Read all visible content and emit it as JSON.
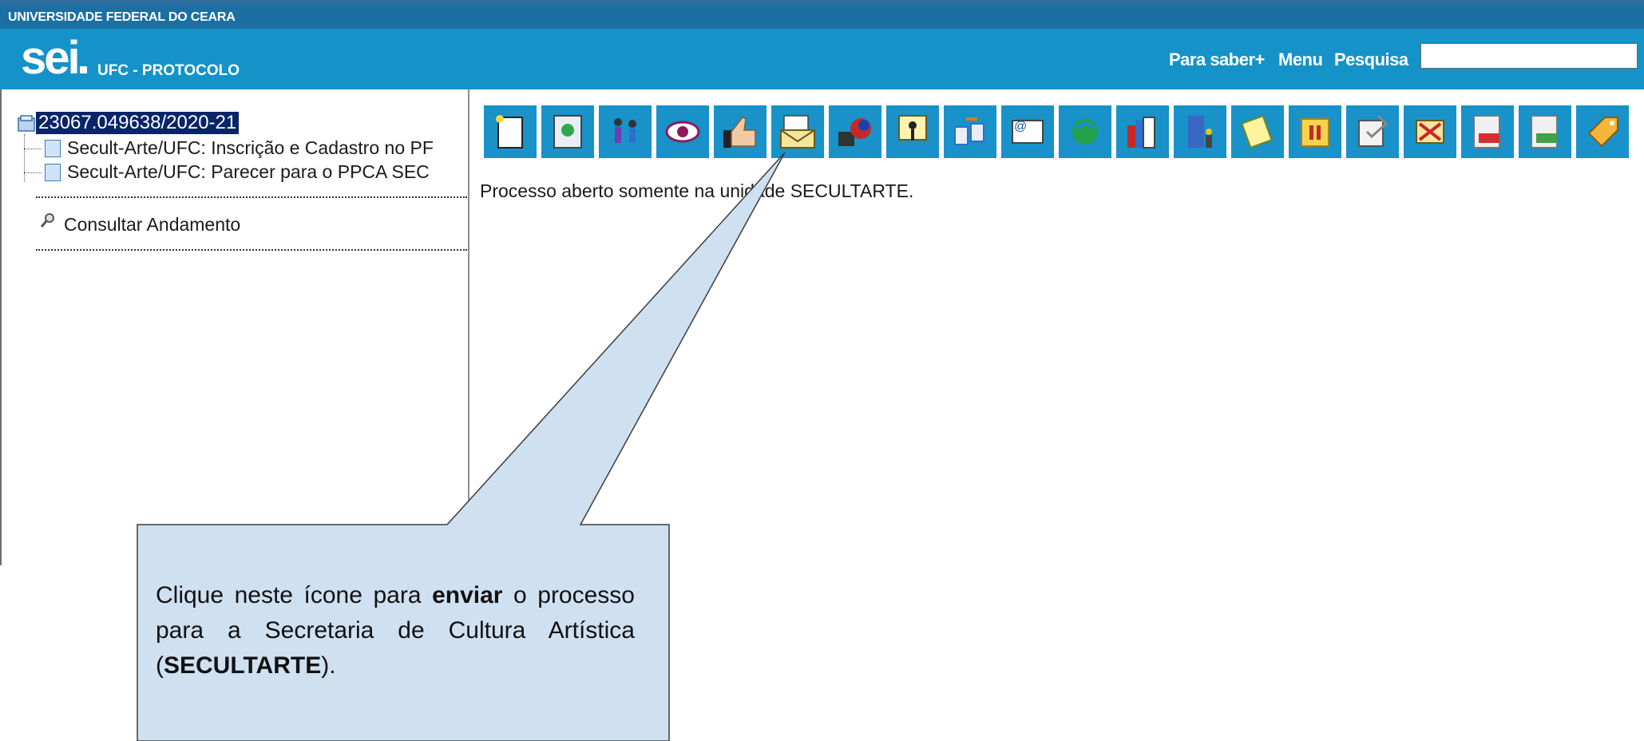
{
  "header": {
    "org_name": "UNIVERSIDADE FEDERAL DO CEARA",
    "logo_text": "sei",
    "system_name": "UFC - PROTOCOLO",
    "links": [
      "Para saber+",
      "Menu",
      "Pesquisa"
    ],
    "search_value": ""
  },
  "tree": {
    "process_number": "23067.049638/2020-21",
    "documents": [
      "Secult-Arte/UFC: Inscrição e Cadastro no PF",
      "Secult-Arte/UFC: Parecer para o PPCA SEC"
    ],
    "consultar_label": "Consultar Andamento"
  },
  "toolbar": {
    "icons": [
      "new-document-icon",
      "start-related-process-icon",
      "manage-interested-icon",
      "access-icon",
      "approve-icon",
      "send-process-icon",
      "update-progress-icon",
      "assign-process-icon",
      "associate-icon",
      "email-icon",
      "relationship-icon",
      "library-icon",
      "unit-icon",
      "annotation-icon",
      "suspend-icon",
      "checkmark-icon",
      "cancel-icon",
      "pdf-icon",
      "zip-icon",
      "tag-icon"
    ]
  },
  "main": {
    "status_text": "Processo aberto somente na unidade SECULTARTE."
  },
  "callout": {
    "part1": "Clique neste ícone para ",
    "bold1": "enviar",
    "part2": " o processo para a Secretaria de Cultura Artística (",
    "bold2": "SECULTARTE",
    "part3": ")."
  },
  "colors": {
    "header_bg": "#1592c8",
    "topstrip_bg": "#1c6fa3",
    "callout_fill": "#cfe0f1",
    "selection_bg": "#0a246a"
  }
}
